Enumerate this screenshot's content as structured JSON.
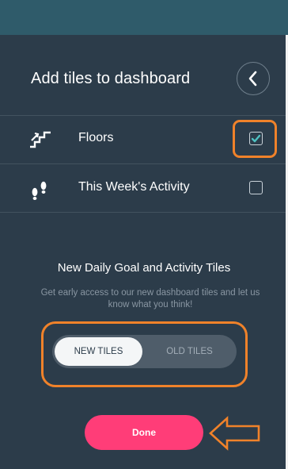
{
  "header": {
    "title": "Add tiles to dashboard",
    "back_icon": "chevron-left-icon"
  },
  "tiles": [
    {
      "label": "Floors",
      "icon": "stairs-icon",
      "checked": true
    },
    {
      "label": "This Week's Activity",
      "icon": "footprints-icon",
      "checked": false
    }
  ],
  "new_tiles_section": {
    "heading": "New Daily Goal and Activity Tiles",
    "description": "Get early access to our new dashboard tiles and let us know what you think!",
    "toggle": {
      "options": [
        "NEW TILES",
        "OLD TILES"
      ],
      "selected": "NEW TILES"
    }
  },
  "footer": {
    "done_label": "Done"
  },
  "colors": {
    "panel": "#2c3c4a",
    "top_band": "#2f5b6a",
    "accent_pink": "#ff3d78",
    "annotation_orange": "#f0822a",
    "check_teal": "#4fc2c2"
  }
}
